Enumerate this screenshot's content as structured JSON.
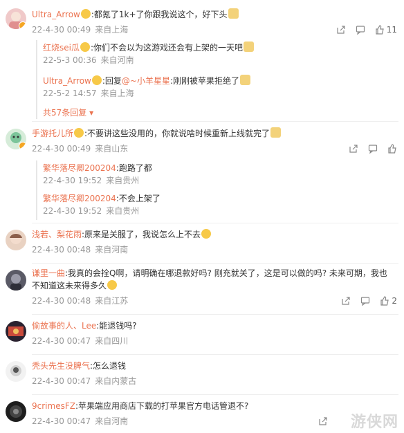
{
  "comments": [
    {
      "user": "Ultra_Arrow",
      "text_before": ":都氪了1k+了你跟我说这个，好下头",
      "date": "22-4-30 00:49",
      "location": "来自上海",
      "likes": "11",
      "replies": [
        {
          "user": "红烧sei瓜",
          "text": ":你们不会以为这游戏还会有上架的一天吧",
          "date": "22-5-3 00:36",
          "location": "来自河南"
        },
        {
          "user": "Ultra_Arrow",
          "reply_prefix": ":回复",
          "reply_to": "@~小羊星星",
          "text": ":刚刚被苹果拒绝了",
          "date": "22-5-2 14:57",
          "location": "来自上海"
        }
      ],
      "more_replies": "共57条回复"
    },
    {
      "user": "手游托儿所",
      "text_before": ":不要讲这些没用的，你就说啥时候重新上线就完了",
      "date": "22-4-30 00:49",
      "location": "来自山东",
      "likes": "",
      "replies": [
        {
          "user": "繁华落尽卿200204",
          "text": ":跑路了都",
          "date": "22-4-30 19:52",
          "location": "来自贵州"
        },
        {
          "user": "繁华落尽卿200204",
          "text": ":不会上架了",
          "date": "22-4-30 19:52",
          "location": "来自贵州"
        }
      ]
    },
    {
      "user": "浅若、梨花雨",
      "text_before": ":原来是关服了，我说怎么上不去",
      "date": "22-4-30 00:48",
      "location": "来自河南",
      "likes": ""
    },
    {
      "user": "谦里一曲",
      "text_before": ":我真的会拴Q啊，请明确在哪退款好吗? 刚充就关了，这是可以做的吗? 未来可期，我也不知道这未来得多久",
      "date": "22-4-30 00:48",
      "location": "来自江苏",
      "likes": "2"
    },
    {
      "user": "偷故事的人、Lee",
      "text_before": ":能退钱吗?",
      "date": "22-4-30 00:47",
      "location": "来自四川",
      "likes": ""
    },
    {
      "user": "秃头先生没脾气",
      "text_before": ":怎么退钱",
      "date": "22-4-30 00:47",
      "location": "来自内蒙古",
      "likes": ""
    },
    {
      "user": "9crimesFZ",
      "text_before": ":苹果端应用商店下载的打苹果官方电话管退不?",
      "date": "22-4-30 00:47",
      "location": "来自河南",
      "likes": ""
    }
  ],
  "watermark": "游侠网",
  "colors": {
    "username": "#eb7350",
    "meta": "#999999",
    "divider": "#eeeeee"
  }
}
